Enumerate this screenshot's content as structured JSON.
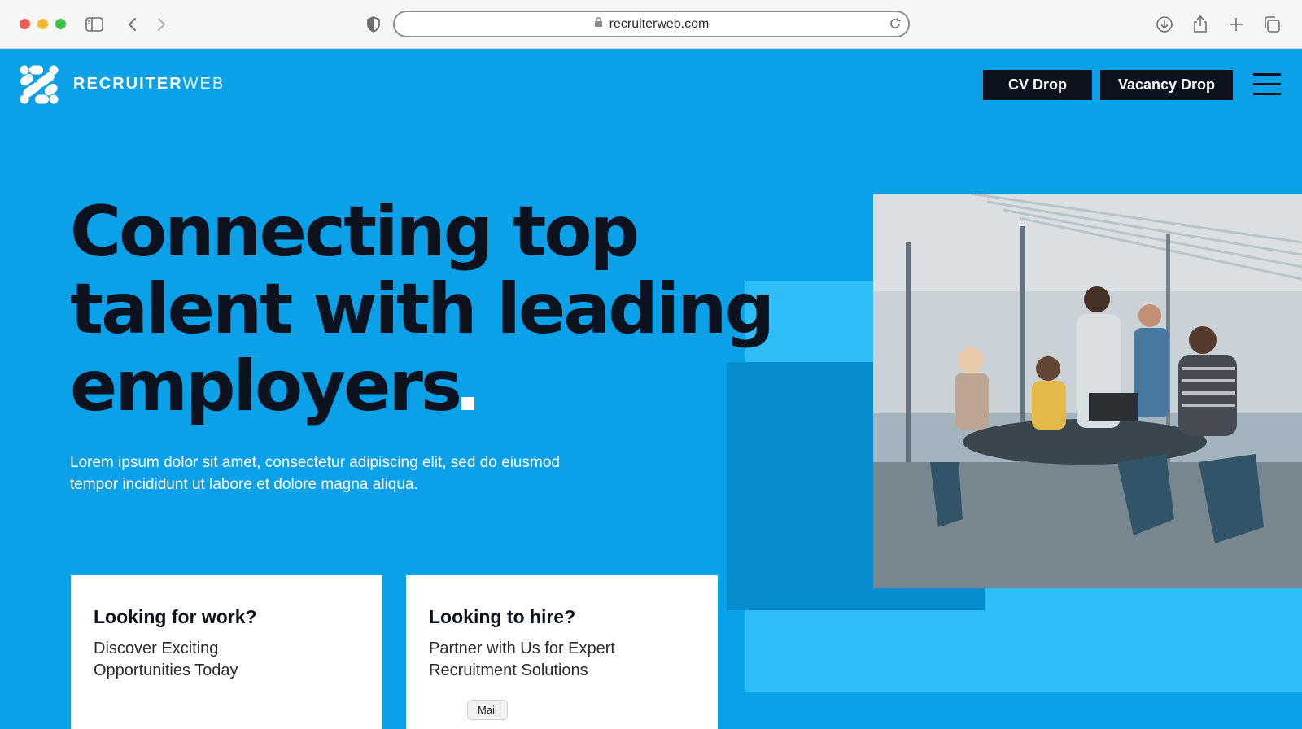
{
  "browser": {
    "url": "recruiterweb.com"
  },
  "header": {
    "brand_bold": "RECRUITER",
    "brand_light": "WEB",
    "cv_drop": "CV Drop",
    "vacancy_drop": "Vacancy Drop"
  },
  "hero": {
    "headline_line1": "Connecting top",
    "headline_line2": "talent with leading",
    "headline_line3": "employers",
    "subtitle_line1": "Lorem ipsum dolor sit amet, consectetur adipiscing elit, sed do eiusmod",
    "subtitle_line2": "tempor incididunt ut labore et dolore magna aliqua."
  },
  "cards": [
    {
      "title": "Looking for work?",
      "line1": "Discover Exciting",
      "line2": "Opportunities Today"
    },
    {
      "title": "Looking to hire?",
      "line1": "Partner with Us for Expert",
      "line2": "Recruitment Solutions"
    }
  ],
  "tooltip": "Mail",
  "colors": {
    "page_bg": "#0aa1e9",
    "accent_light": "#2dbdf8",
    "accent_dark": "#078cd0",
    "ink": "#0c121e"
  }
}
